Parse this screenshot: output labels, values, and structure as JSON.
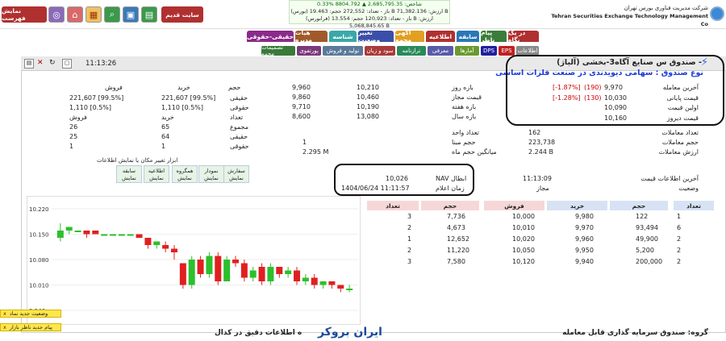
{
  "top": {
    "buttons": [
      "نمایش فهرست",
      "سایت قدیم"
    ],
    "market_lines": [
      "شاخص: 2,685,795.35 ▲ 8804.792 %0.33",
      "(بورس) باز - تعداد: 272,552 حجم: 19.463 B ارزش: 71,382.136 B",
      "(فرابورس) باز - تعداد: 120,923 حجم: 13.554 B ارزش: 5,068,845.65 B"
    ],
    "org_fa": "شرکت مدیریت فناوری بورس تهران",
    "org_en": "Tehran Securities Exchange Technology Management Co"
  },
  "tabs_row1": [
    {
      "label": "در یک نگاه",
      "color": "#b03030"
    },
    {
      "label": "پیام ناظر",
      "color": "#3a7d3a"
    },
    {
      "label": "سابقه",
      "color": "#2a77b5"
    },
    {
      "label": "اطلاعیه",
      "color": "#b03030"
    },
    {
      "label": "آگهی مجمع",
      "color": "#e0a020"
    },
    {
      "label": "تغییر وضعیت",
      "color": "#3a4fa8"
    },
    {
      "label": "شناسه",
      "color": "#3aa8a8"
    },
    {
      "label": "هیات مدیره",
      "color": "#a05a2a"
    },
    {
      "label": "حقیقی-حقوقی",
      "color": "#8a2a8a"
    }
  ],
  "tabs_row2": [
    {
      "label": "اطلاعات",
      "color": "#888"
    },
    {
      "label": "EPS",
      "color": "#c02020"
    },
    {
      "label": "DPS",
      "color": "#2020a0"
    },
    {
      "label": "آمارها",
      "color": "#6a9a30"
    },
    {
      "label": "معرفی",
      "color": "#5a5aaa"
    },
    {
      "label": "ترازنامه",
      "color": "#2a8a5a"
    },
    {
      "label": "سود و زیان",
      "color": "#aa3a3a"
    },
    {
      "label": "تولید و فروش",
      "color": "#5a7a9a"
    },
    {
      "label": "پورتفوی",
      "color": "#7a3a7a"
    },
    {
      "label": "تصمیمات مجمع",
      "color": "#3a7a3a"
    }
  ],
  "time": "11:13:26",
  "title": "صندوق س صنایع آگاه3-بخشی (آلیاژ) - ",
  "subtitle": "نوع صندوق : سهامی دیویدندی در صنعت فلزات اساسی",
  "price": {
    "last_label": "آخرین معامله",
    "last": "9,970",
    "last_chg": "(190)",
    "last_pct": "[-1.87%]",
    "close_label": "قیمت پایانی",
    "close": "10,030",
    "close_chg": "(130)",
    "close_pct": "[-1.28%]",
    "first_label": "اولین قیمت",
    "first": "10,090",
    "yest_label": "قیمت دیروز",
    "yest": "10,160"
  },
  "ranges": [
    {
      "label": "بازه روز",
      "a": "9,960",
      "b": "10,210"
    },
    {
      "label": "قیمت مجاز",
      "a": "9,860",
      "b": "10,460"
    },
    {
      "label": "بازه هفته",
      "a": "9,710",
      "b": "10,190"
    },
    {
      "label": "بازه سال",
      "a": "8,600",
      "b": "13,080"
    }
  ],
  "stats": [
    {
      "label": "تعداد معاملات",
      "v": "162",
      "v2": ""
    },
    {
      "label": "حجم معاملات",
      "v": "223,738",
      "v2": ""
    },
    {
      "label": "ارزش معاملات",
      "v": "2.244 B",
      "v2": ""
    }
  ],
  "stats_mid": [
    {
      "label": "تعداد واحد",
      "v": ""
    },
    {
      "label": "حجم مبنا",
      "v": "1"
    },
    {
      "label": "میانگین حجم ماه",
      "v": "2.295 M"
    }
  ],
  "hq": {
    "cols": [
      "حجم",
      "خرید",
      "فروش"
    ],
    "rows": [
      {
        "label": "حقیقی",
        "buy": "221,607 [99.5%]",
        "sell": "221,607 [99.5%]"
      },
      {
        "label": "حقوقی",
        "buy": "1,110 [0.5%]",
        "sell": "1,110 [0.5%]"
      },
      {
        "label": "تعداد",
        "buy": "خرید",
        "sell": "فروش"
      },
      {
        "label": "مجموع",
        "buy": "65",
        "sell": "26"
      },
      {
        "label": "حقیقی",
        "buy": "64",
        "sell": "25"
      },
      {
        "label": "حقوقی",
        "buy": "1",
        "sell": "1"
      }
    ]
  },
  "tools": {
    "title": "ابزار تغییر مکان یا نمایش اطلاعات",
    "items": [
      {
        "a": "سفارش",
        "b": "نمایش"
      },
      {
        "a": "نمودار",
        "b": "نمایش"
      },
      {
        "a": "همگروه",
        "b": "نمایش"
      },
      {
        "a": "اطلاعیه",
        "b": "نمایش"
      },
      {
        "a": "سابقه",
        "b": "نمایش"
      }
    ]
  },
  "info": {
    "last_info_label": "آخرین اطلاعات قیمت",
    "last_info": "11:13:09",
    "status_label": "وضعیت",
    "status": "مجاز",
    "nav_label": "NAV ابطال",
    "nav": "10,026",
    "notice_label": "زمان اعلام",
    "notice": "1404/06/24 11:11:57"
  },
  "orderbook": {
    "headers": [
      "تعداد",
      "حجم",
      "خرید",
      "فروش",
      "حجم",
      "تعداد"
    ],
    "rows": [
      [
        "1",
        "122",
        "9,980",
        "10,000",
        "7,736",
        "3"
      ],
      [
        "6",
        "93,494",
        "9,970",
        "10,010",
        "4,673",
        "2"
      ],
      [
        "2",
        "49,900",
        "9,960",
        "10,020",
        "12,652",
        "1"
      ],
      [
        "2",
        "5,200",
        "9,950",
        "10,050",
        "11,220",
        "2"
      ],
      [
        "2",
        "200,000",
        "9,940",
        "10,120",
        "7,580",
        "3"
      ]
    ]
  },
  "chart_data": {
    "type": "candlestick",
    "yticks": [
      "10.220",
      "10.150",
      "10.080",
      "10.010",
      "9.940"
    ],
    "ylim": [
      9.92,
      10.24
    ],
    "candles": [
      {
        "o": 10.14,
        "c": 10.16,
        "h": 10.18,
        "l": 10.13
      },
      {
        "o": 10.16,
        "c": 10.17,
        "h": 10.17,
        "l": 10.15
      },
      {
        "o": 10.16,
        "c": 10.16,
        "h": 10.16,
        "l": 10.16
      },
      {
        "o": 10.16,
        "c": 10.15,
        "h": 10.16,
        "l": 10.14
      },
      {
        "o": 10.16,
        "c": 10.15,
        "h": 10.16,
        "l": 10.15
      },
      {
        "o": 10.15,
        "c": 10.15,
        "h": 10.15,
        "l": 10.15
      },
      {
        "o": 10.15,
        "c": 10.15,
        "h": 10.15,
        "l": 10.15
      },
      {
        "o": 10.15,
        "c": 10.15,
        "h": 10.15,
        "l": 10.15
      },
      {
        "o": 10.15,
        "c": 10.15,
        "h": 10.15,
        "l": 10.15
      },
      {
        "o": 10.15,
        "c": 10.14,
        "h": 10.15,
        "l": 10.14
      },
      {
        "o": 10.14,
        "c": 10.12,
        "h": 10.14,
        "l": 10.11
      },
      {
        "o": 10.12,
        "c": 10.13,
        "h": 10.13,
        "l": 10.11
      },
      {
        "o": 10.12,
        "c": 10.11,
        "h": 10.13,
        "l": 10.1
      },
      {
        "o": 10.11,
        "c": 10.1,
        "h": 10.12,
        "l": 10.08
      },
      {
        "o": 10.07,
        "c": 10.01,
        "h": 10.07,
        "l": 10.0
      },
      {
        "o": 10.01,
        "c": 10.08,
        "h": 10.09,
        "l": 10.0
      },
      {
        "o": 10.08,
        "c": 10.04,
        "h": 10.09,
        "l": 10.03
      },
      {
        "o": 10.04,
        "c": 10.09,
        "h": 10.1,
        "l": 10.03
      },
      {
        "o": 10.09,
        "c": 10.02,
        "h": 10.1,
        "l": 10.01
      },
      {
        "o": 10.02,
        "c": 10.08,
        "h": 10.09,
        "l": 10.02
      },
      {
        "o": 10.08,
        "c": 10.07,
        "h": 10.09,
        "l": 10.06
      },
      {
        "o": 10.07,
        "c": 10.03,
        "h": 10.08,
        "l": 10.02
      },
      {
        "o": 10.03,
        "c": 10.05,
        "h": 10.06,
        "l": 10.02
      },
      {
        "o": 10.06,
        "c": 10.02,
        "h": 10.07,
        "l": 10.01
      },
      {
        "o": 10.02,
        "c": 10.06,
        "h": 10.07,
        "l": 10.01
      },
      {
        "o": 10.06,
        "c": 10.04,
        "h": 10.06,
        "l": 10.03
      },
      {
        "o": 10.04,
        "c": 10.05,
        "h": 10.06,
        "l": 10.03
      },
      {
        "o": 10.05,
        "c": 10.02,
        "h": 10.06,
        "l": 10.01
      },
      {
        "o": 10.02,
        "c": 10.03,
        "h": 10.04,
        "l": 10.01
      },
      {
        "o": 10.03,
        "c": 10.01,
        "h": 10.04,
        "l": 10.0
      },
      {
        "o": 10.01,
        "c": 10.02,
        "h": 10.02,
        "l": 10.0
      },
      {
        "o": 10.02,
        "c": 10.01,
        "h": 10.02,
        "l": 10.0
      },
      {
        "o": 10.01,
        "c": 10.0,
        "h": 10.01,
        "l": 9.99
      },
      {
        "o": 10.0,
        "c": 10.0,
        "h": 10.01,
        "l": 9.99
      }
    ]
  },
  "notices": [
    "وضعیت جدید نماد",
    "پیام جدید ناظر بازار"
  ],
  "notice_x": "x",
  "footer": {
    "group": "گروه: صندوق سرمایه گذاری قابل معامله",
    "text": "ه اطلاعات دقیق در کدال",
    "brand": "ایران بروکر"
  }
}
